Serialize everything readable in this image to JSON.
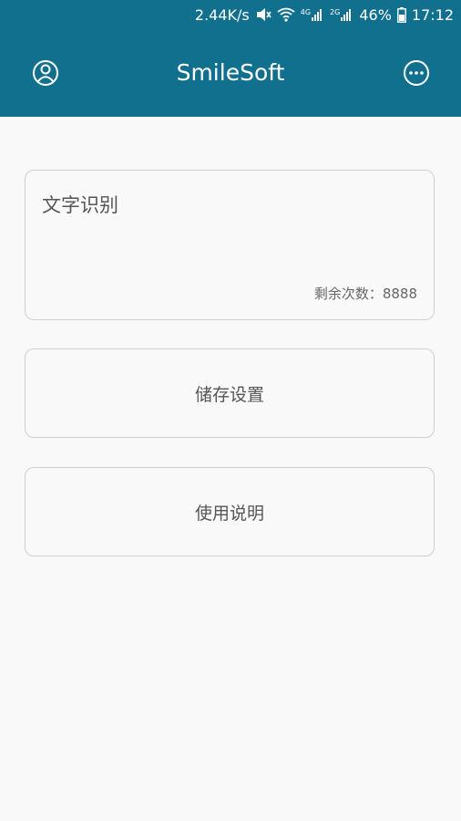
{
  "status_bar": {
    "network_speed": "2.44K/s",
    "network_type_1": "4G",
    "network_type_2": "2G",
    "battery": "46%",
    "time": "17:12"
  },
  "app_bar": {
    "title": "SmileSoft",
    "left_icon": "user-circle-icon",
    "right_icon": "more-options-icon"
  },
  "ocr_card": {
    "title": "文字识别",
    "remaining_label": "剩余次数：8888"
  },
  "storage_button": {
    "label": "储存设置"
  },
  "help_button": {
    "label": "使用说明"
  },
  "colors": {
    "header": "#12708f",
    "background": "#f9f9f9",
    "card_border": "#cfcfcf"
  }
}
